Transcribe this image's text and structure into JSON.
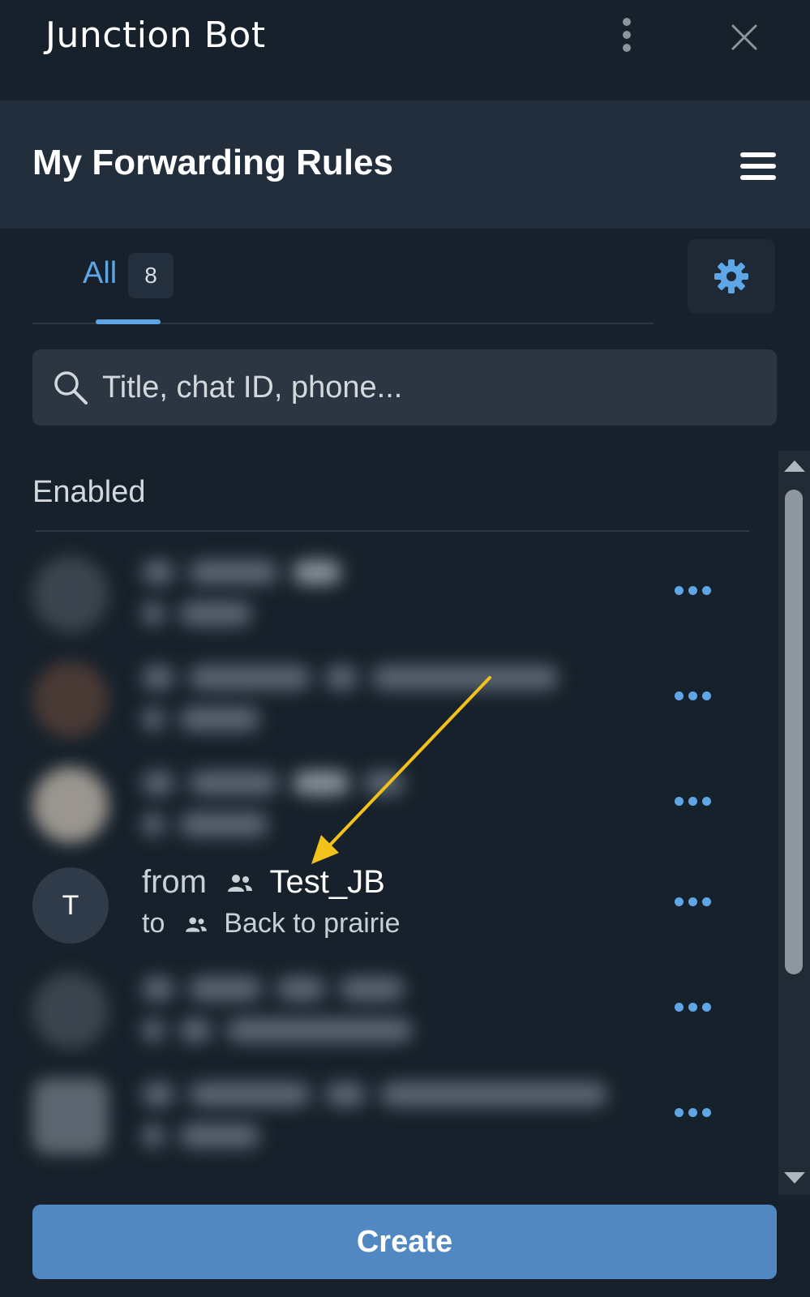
{
  "window": {
    "title": "Junction Bot"
  },
  "header": {
    "title": "My Forwarding Rules"
  },
  "tabs": [
    {
      "label": "All",
      "count": "8"
    }
  ],
  "search": {
    "placeholder": "Title, chat ID, phone..."
  },
  "section": {
    "label": "Enabled"
  },
  "rules": [
    {
      "blurred": true
    },
    {
      "blurred": true
    },
    {
      "blurred": true
    },
    {
      "blurred": false,
      "avatar": "T",
      "from_label": "from",
      "from_chat": "Test_JB",
      "to_label": "to",
      "to_chat": "Back to prairie"
    },
    {
      "blurred": true
    },
    {
      "blurred": true
    }
  ],
  "footer": {
    "create_label": "Create"
  },
  "colors": {
    "accent": "#5fa6e6",
    "button": "#5288c1",
    "background": "#17212b",
    "header": "#232e3c",
    "annotation_arrow": "#f2c21b"
  },
  "icons": [
    "kebab-menu-icon",
    "close-icon",
    "hamburger-icon",
    "gear-icon",
    "search-icon",
    "group-icon",
    "more-dots-icon"
  ]
}
